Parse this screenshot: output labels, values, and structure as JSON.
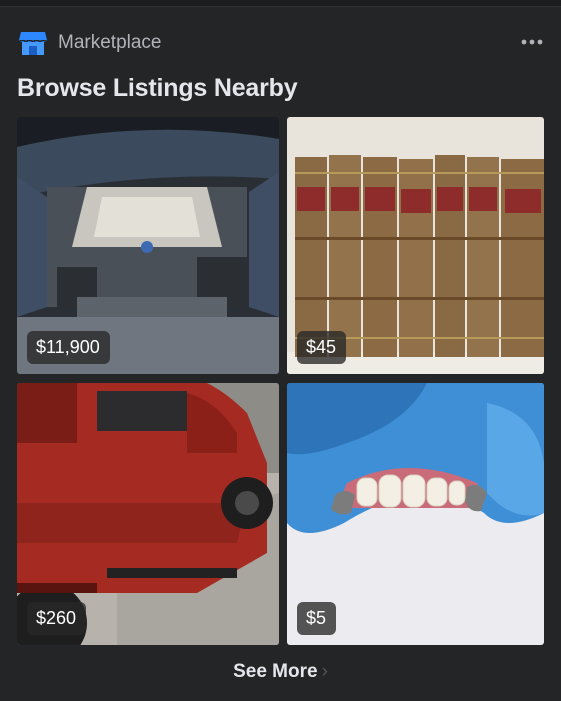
{
  "header": {
    "section_label": "Marketplace",
    "icon": "marketplace-storefront-icon",
    "more_icon": "more-dots-icon"
  },
  "title": "Browse Listings Nearby",
  "listings": [
    {
      "price": "$11,900",
      "image": "car engine bay"
    },
    {
      "price": "$45",
      "image": "antique book set"
    },
    {
      "price": "$260",
      "image": "red pickup truck"
    },
    {
      "price": "$5",
      "image": "dentures in gloved hand"
    }
  ],
  "footer": {
    "see_more_label": "See More",
    "chevron_icon": "chevron-right-icon"
  },
  "colors": {
    "background": "#242526",
    "text_primary": "#e4e6eb",
    "text_secondary": "#b0b3b8",
    "brand_blue": "#1877f2"
  }
}
